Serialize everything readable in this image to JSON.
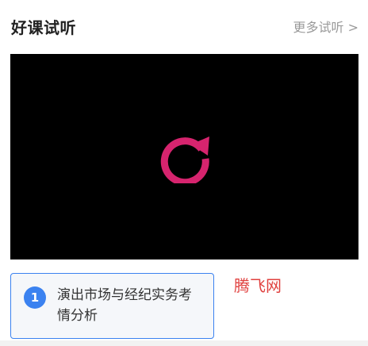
{
  "section": {
    "title": "好课试听",
    "more_label": "更多试听 >"
  },
  "player": {
    "overlay_icon": "replay-icon",
    "accent_color": "#d6246e"
  },
  "lessons": [
    {
      "index": "1",
      "title": "演出市场与经纪实务考情分析"
    }
  ],
  "watermark": "腾飞网",
  "colors": {
    "active_border": "#3b82f0",
    "watermark": "#e0413f"
  }
}
